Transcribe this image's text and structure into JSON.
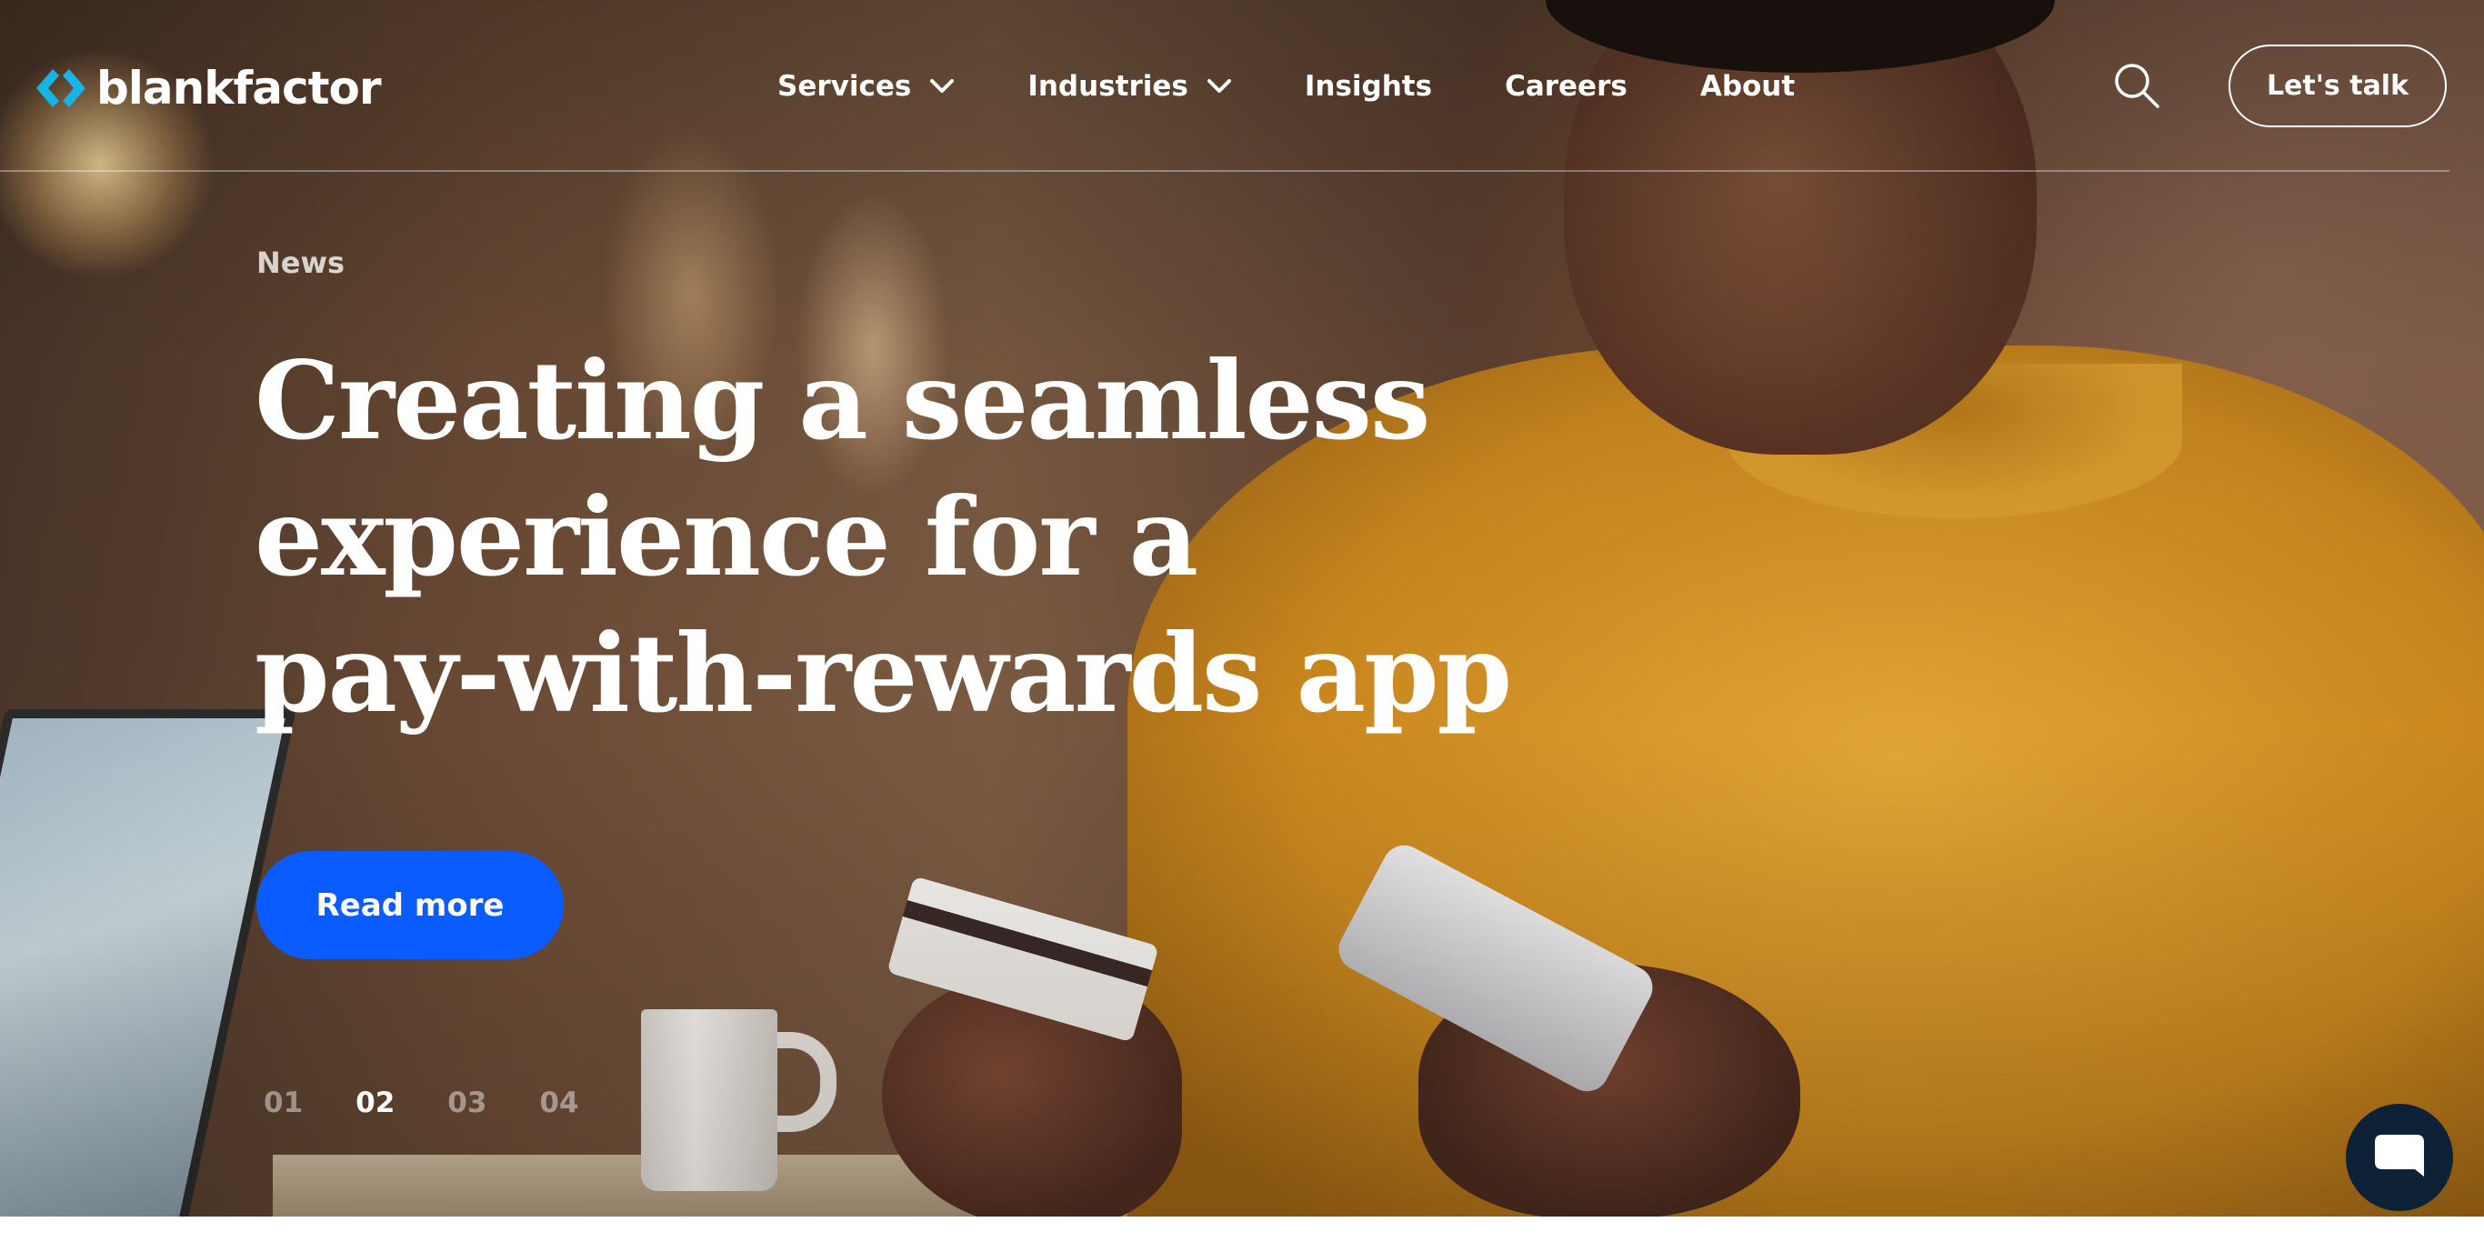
{
  "brand": {
    "name": "blankfactor",
    "accent_color": "#1ab3e6"
  },
  "nav": {
    "items": [
      {
        "label": "Services",
        "has_dropdown": true
      },
      {
        "label": "Industries",
        "has_dropdown": true
      },
      {
        "label": "Insights",
        "has_dropdown": false
      },
      {
        "label": "Careers",
        "has_dropdown": false
      },
      {
        "label": "About",
        "has_dropdown": false
      }
    ],
    "search_icon": "search-icon",
    "cta_label": "Let's talk"
  },
  "hero": {
    "eyebrow": "News",
    "headline_lines": [
      "Creating a seamless",
      "experience for a",
      "pay-with-rewards app"
    ],
    "button_label": "Read more",
    "button_color": "#0b5cff"
  },
  "pager": {
    "items": [
      "01",
      "02",
      "03",
      "04"
    ],
    "active_index": 1
  },
  "chat": {
    "icon": "chat-bubble-icon",
    "background": "#0d2236"
  }
}
